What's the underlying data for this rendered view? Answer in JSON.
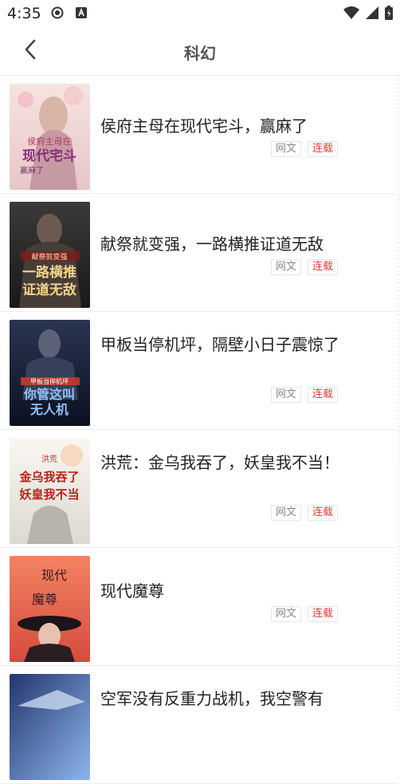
{
  "status_bar": {
    "time": "4:35",
    "icons": [
      "record-icon",
      "a-icon",
      "wifi-icon",
      "signal-icon",
      "battery-icon"
    ]
  },
  "header": {
    "title": "科幻",
    "back_icon": "chevron-left-icon"
  },
  "books": [
    {
      "title": "侯府主母在现代宅斗，赢麻了",
      "tags": [
        "网文",
        "连载"
      ],
      "cover_text": [
        "侯府主母在",
        "现代宅斗",
        "赢麻了"
      ],
      "cover_palette": [
        "#f3d7d4",
        "#b94a6f"
      ]
    },
    {
      "title": "献祭就变强，一路横推证道无敌",
      "tags": [
        "网文",
        "连载"
      ],
      "cover_text": [
        "献祭就变强",
        "一路横推",
        "证道无敌"
      ],
      "cover_palette": [
        "#2d2c2c",
        "#c8a24a"
      ]
    },
    {
      "title": "甲板当停机坪，隔壁小日子震惊了",
      "tags": [
        "网文",
        "连载"
      ],
      "cover_text": [
        "甲板当停机坪",
        "你管这叫",
        "无人机"
      ],
      "cover_palette": [
        "#1a2236",
        "#4a7ad8"
      ]
    },
    {
      "title": "洪荒：金乌我吞了，妖皇我不当！",
      "tags": [
        "网文",
        "连载"
      ],
      "cover_text": [
        "洪荒",
        "金乌我吞了",
        "妖皇我不当"
      ],
      "cover_palette": [
        "#f4f1ec",
        "#c4352d"
      ]
    },
    {
      "title": "现代魔尊",
      "tags": [
        "网文",
        "连载"
      ],
      "cover_text": [
        "现代",
        "魔尊"
      ],
      "cover_palette": [
        "#ef6b4e",
        "#2a1e23"
      ]
    },
    {
      "title": "空军没有反重力战机，我空警有",
      "tags": [
        "网文",
        "连载"
      ],
      "cover_text": [],
      "cover_palette": [
        "#1c2a5c",
        "#6aa1e8"
      ]
    }
  ],
  "colors": {
    "accent_red": "#e0403a",
    "tag_gray": "#8a8a8a"
  }
}
